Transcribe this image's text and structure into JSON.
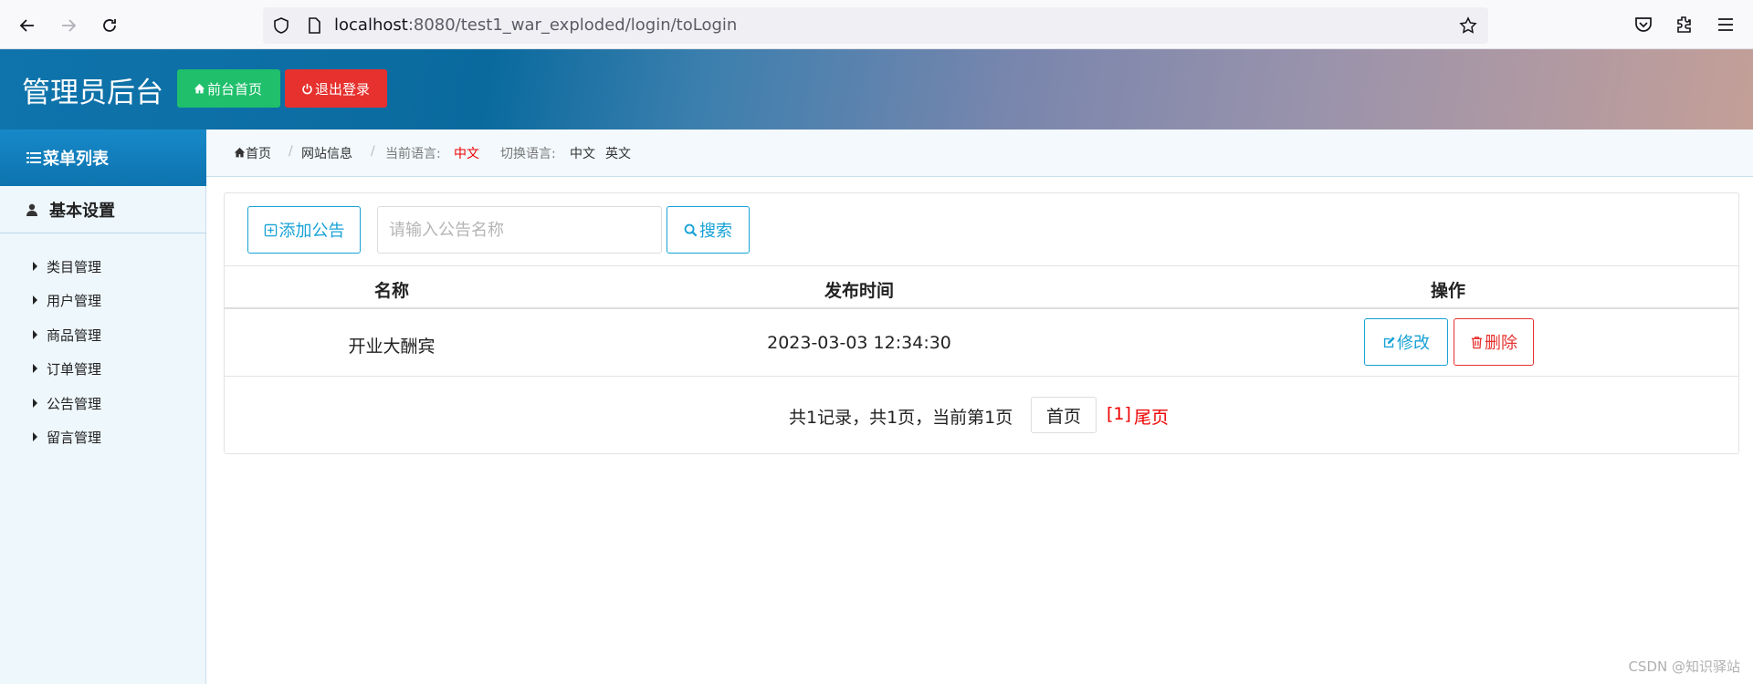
{
  "browser": {
    "url_host": "localhost",
    "url_path": ":8080/test1_war_exploded/login/toLogin"
  },
  "header": {
    "title": "管理员后台",
    "front_home_label": "前台首页",
    "logout_label": "退出登录"
  },
  "sidebar": {
    "menu_title": "菜单列表",
    "group_label": "基本设置",
    "items": [
      {
        "label": "类目管理"
      },
      {
        "label": "用户管理"
      },
      {
        "label": "商品管理"
      },
      {
        "label": "订单管理"
      },
      {
        "label": "公告管理"
      },
      {
        "label": "留言管理"
      }
    ]
  },
  "breadcrumb": {
    "home": "首页",
    "site_info": "网站信息",
    "current_lang_label": "当前语言:",
    "current_lang": "中文",
    "switch_lang_label": "切换语言:",
    "lang_zh": "中文",
    "lang_en": "英文"
  },
  "toolbar": {
    "add_label": "添加公告",
    "search_placeholder": "请输入公告名称",
    "search_label": "搜索"
  },
  "table": {
    "columns": [
      "名称",
      "发布时间",
      "操作"
    ],
    "rows": [
      {
        "name": "开业大酬宾",
        "time": "2023-03-03 12:34:30",
        "edit_label": "修改",
        "delete_label": "删除"
      }
    ]
  },
  "pager": {
    "summary": "共1记录，共1页，当前第1页",
    "first_label": "首页",
    "current": "[1]",
    "last_label": "尾页"
  },
  "watermark": "CSDN @知识驿站",
  "colors": {
    "primary": "#17a2d6",
    "danger": "#e6312e",
    "success": "#1fbf6b",
    "sidebar_head": "#0d73af"
  }
}
